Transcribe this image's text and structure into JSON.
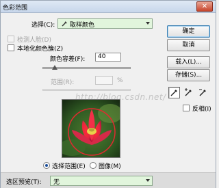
{
  "window": {
    "title": "色彩范围",
    "close_label": "✕"
  },
  "select": {
    "label": "选择(C):",
    "value": "取样颜色"
  },
  "detect_faces": {
    "label": "检测人脸(D)",
    "checked": false,
    "disabled": true
  },
  "localized": {
    "label": "本地化颜色簇(Z)",
    "checked": false
  },
  "fuzziness": {
    "label": "颜色容差(F):",
    "value": "40"
  },
  "range": {
    "label": "范围(R):",
    "value": "",
    "unit": "%"
  },
  "buttons": {
    "ok": "确定",
    "cancel": "取消",
    "load": "载入(L)...",
    "save": "存储(S)..."
  },
  "tools": {
    "items": [
      {
        "name": "eyedropper-icon",
        "glyph": "⁄"
      },
      {
        "name": "eyedropper-plus-icon",
        "glyph": "+"
      },
      {
        "name": "eyedropper-minus-icon",
        "glyph": "−"
      }
    ]
  },
  "invert": {
    "label": "反相(I)",
    "checked": false
  },
  "view": {
    "selection_label": "选择范围(E)",
    "image_label": "图像(M)",
    "selected": "selection"
  },
  "selection_preview": {
    "label": "选区预览(T):",
    "value": "无"
  },
  "watermark": "http://blog.csdn.net/",
  "colors": {
    "title_bar": "#c7d6ea",
    "select_bg": "#e1f5dc",
    "default_button_border": "#3c7fb1",
    "close_button": "#c7452c"
  }
}
